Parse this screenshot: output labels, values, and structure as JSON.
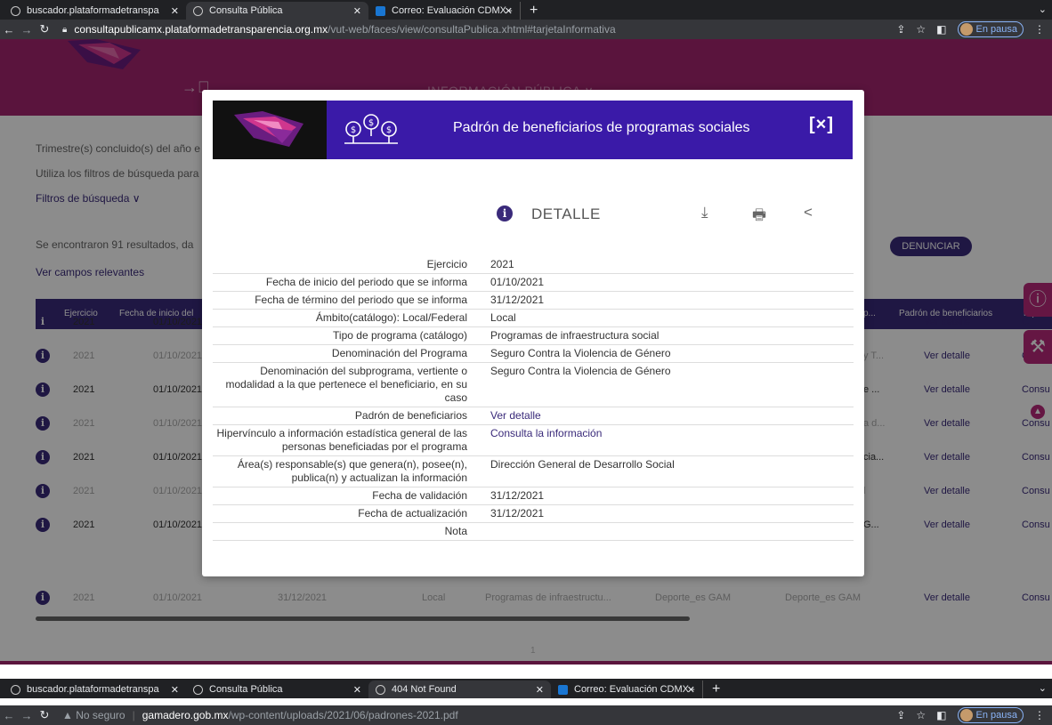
{
  "browser_top": {
    "tabs": [
      {
        "label": "buscador.plataformadetranspa"
      },
      {
        "label": "Consulta Pública"
      },
      {
        "label": "Correo: Evaluación CDMX - Ou"
      }
    ],
    "url_domain": "consultapublicamx.plataformadetransparencia.org.mx",
    "url_path": "/vut-web/faces/view/consultaPublica.xhtml#tarjetaInformativa",
    "profile_label": "En pausa"
  },
  "page": {
    "menu_label": "INFORMACIÓN PÚBLICA ∨",
    "trimestre_text": "Trimestre(s) concluido(s) del año e",
    "filtros_hint": "Utiliza los filtros de búsqueda para",
    "filtros_label": "Filtros de búsqueda ∨",
    "results_text": "Se encontraron 91 resultados, da",
    "campos_link": "Ver campos relevantes",
    "denunciar_label": "DENUNCIAR",
    "page_number": "1",
    "table_headers": {
      "ejercicio": "Ejercicio",
      "fecha_inicio": "Fecha de inicio del",
      "col_p": "p...",
      "padron": "Padrón de beneficiarios",
      "hipervinculo": "Hipervín"
    },
    "rows": [
      {
        "year": "2021",
        "date": "01/10/2021",
        "col_p": "",
        "detalle": "Ver detalle",
        "consu": "C"
      },
      {
        "year": "2021",
        "date": "01/10/2021",
        "col_p": "y T...",
        "detalle": "Ver detalle",
        "consu": "C"
      },
      {
        "year": "2021",
        "date": "01/10/2021",
        "col_p": "e ...",
        "detalle": "Ver detalle",
        "consu": "Consu"
      },
      {
        "year": "2021",
        "date": "01/10/2021",
        "col_p": "a d...",
        "detalle": "Ver detalle",
        "consu": "Consu"
      },
      {
        "year": "2021",
        "date": "01/10/2021",
        "col_p": "cia...",
        "detalle": "Ver detalle",
        "consu": "Consu"
      },
      {
        "year": "2021",
        "date": "01/10/2021",
        "col_p": "l",
        "detalle": "Ver detalle",
        "consu": "Consu"
      },
      {
        "year": "2021",
        "date": "01/10/2021",
        "col_p": "G...",
        "detalle": "Ver detalle",
        "consu": "Consu"
      }
    ],
    "last_row": {
      "year": "2021",
      "date": "01/10/2021",
      "end_date": "31/12/2021",
      "ambito": "Local",
      "tipo": "Programas de infraestructu...",
      "deporte1": "Deporte_es GAM",
      "deporte2": "Deporte_es GAM",
      "detalle": "Ver detalle",
      "consu": "Consu"
    }
  },
  "modal": {
    "title": "Padrón de beneficiarios de programas sociales",
    "close_label": "[×]",
    "detalle_label": "DETALLE",
    "fields": [
      {
        "label": "Ejercicio",
        "value": "2021"
      },
      {
        "label": "Fecha de inicio del periodo que se informa",
        "value": "01/10/2021"
      },
      {
        "label": "Fecha de término del periodo que se informa",
        "value": "31/12/2021"
      },
      {
        "label": "Ámbito(catálogo): Local/Federal",
        "value": "Local"
      },
      {
        "label": "Tipo de programa (catálogo)",
        "value": "Programas de infraestructura social"
      },
      {
        "label": "Denominación del Programa",
        "value": "Seguro Contra la Violencia de Género"
      },
      {
        "label": "Denominación del subprograma, vertiente o modalidad a la que pertenece el beneficiario, en su caso",
        "value": "Seguro Contra la Violencia de Género"
      },
      {
        "label": "Padrón de beneficiarios",
        "value": "Ver detalle"
      },
      {
        "label": "Hipervínculo a información estadística general de las personas beneficiadas por el programa",
        "value": "Consulta la información"
      },
      {
        "label": "Área(s) responsable(s) que genera(n), posee(n), publica(n) y actualizan la información",
        "value": "Dirección General de Desarrollo Social"
      },
      {
        "label": "Fecha de validación",
        "value": "31/12/2021"
      },
      {
        "label": "Fecha de actualización",
        "value": "31/12/2021"
      },
      {
        "label": "Nota",
        "value": ""
      }
    ]
  },
  "browser_bottom": {
    "tabs": [
      {
        "label": "buscador.plataformadetranspa"
      },
      {
        "label": "Consulta Pública"
      },
      {
        "label": "404 Not Found"
      },
      {
        "label": "Correo: Evaluación CDMX - Ou"
      }
    ],
    "not_secure": "No seguro",
    "url_domain": "gamadero.gob.mx",
    "url_path": "/wp-content/uploads/2021/06/padrones-2021.pdf",
    "profile_label": "En pausa"
  },
  "colors": {
    "brand_magenta": "#a5266f",
    "brand_purple": "#3a2a7a",
    "modal_header": "#3a1aa8"
  }
}
